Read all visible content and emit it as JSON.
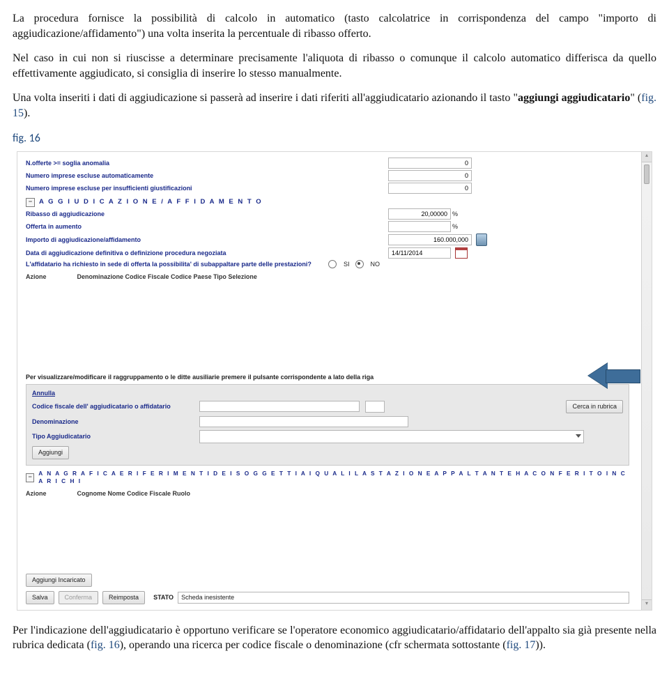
{
  "paragraphs": {
    "p1": "La procedura fornisce la possibilità di calcolo in automatico (tasto calcolatrice in corrispondenza del campo \"importo di aggiudicazione/affidamento\") una volta inserita la percentuale di ribasso offerto.",
    "p2": "Nel caso in cui non si riuscisse a determinare precisamente l'aliquota di ribasso o comunque il calcolo automatico differisca da quello effettivamente aggiudicato, si consiglia di inserire lo stesso manualmente.",
    "p3a": "Una volta inseriti i dati di aggiudicazione si passerà ad inserire i dati  riferiti all'aggiudicatario azionando il tasto \"",
    "p3b_bold": "aggiungi aggiudicatario",
    "p3c": "\" (",
    "p3_figref": "fig. 15",
    "p3d": ").",
    "fig16": "fig. 16",
    "p4a": "Per l'indicazione dell'aggiudicatario è opportuno verificare se l'operatore economico aggiudicatario/affidatario dell'appalto sia già presente nella rubrica dedicata (",
    "p4_fig16": "fig. 16",
    "p4b": "), operando una ricerca per codice fiscale o denominazione (cfr schermata sottostante (",
    "p4_fig17": "fig. 17",
    "p4c": ")).",
    "last": ""
  },
  "top": {
    "nofferte_lbl": "N.offerte >= soglia anomalia",
    "nofferte_val": "0",
    "escluse_lbl": "Numero imprese escluse automaticamente",
    "escluse_val": "0",
    "insuff_lbl": "Numero imprese escluse per insufficienti giustificazioni",
    "insuff_val": "0"
  },
  "sect1": {
    "title": "A G G I U D I C A Z I O N E   /   A F F I D A M E N T O",
    "ribasso_lbl": "Ribasso di aggiudicazione",
    "ribasso_val": "20,00000",
    "ribasso_suff": "%",
    "offerta_lbl": "Offerta in aumento",
    "offerta_suff": "%",
    "importo_lbl": "Importo di aggiudicazione/affidamento",
    "importo_val": "160.000,000",
    "data_lbl": "Data di aggiudicazione definitiva o definizione procedura negoziata",
    "data_val": "14/11/2014",
    "richiesto_lbl": "L'affidatario ha richiesto in sede di offerta la possibilita' di subappaltare parte delle prestazioni?",
    "si": "SI",
    "no": "NO",
    "th_azione": "Azione",
    "th_rest": "Denominazione Codice Fiscale Codice Paese Tipo Selezione"
  },
  "note": "Per visualizzare/modificare il raggruppamento o le ditte ausiliarie premere il pulsante corrispondente a lato della riga",
  "sub": {
    "annulla": "Annulla",
    "cf_lbl": "Codice fiscale dell' aggiudicatario o affidatario",
    "cerca": "Cerca in rubrica",
    "denom_lbl": "Denominazione",
    "tipo_lbl": "Tipo Aggiudicatario",
    "aggiungi": "Aggiungi"
  },
  "sect2": {
    "title": "A N A G R A F I C A   E   R I F E R I M E N T I   D E I   S O G G E T T I   A I   Q U A L I   L A   S T A Z I O N E   A P P A L T A N T E   H A   C O N F E R I T O   I N C A R I C H I",
    "th_azione": "Azione",
    "th_rest": "Cognome Nome Codice Fiscale Ruolo",
    "aggiungi_inc": "Aggiungi Incaricato"
  },
  "bottom": {
    "salva": "Salva",
    "conferma": "Conferma",
    "reimposta": "Reimposta",
    "stato_lbl": "STATO",
    "stato_val": "Scheda inesistente"
  }
}
